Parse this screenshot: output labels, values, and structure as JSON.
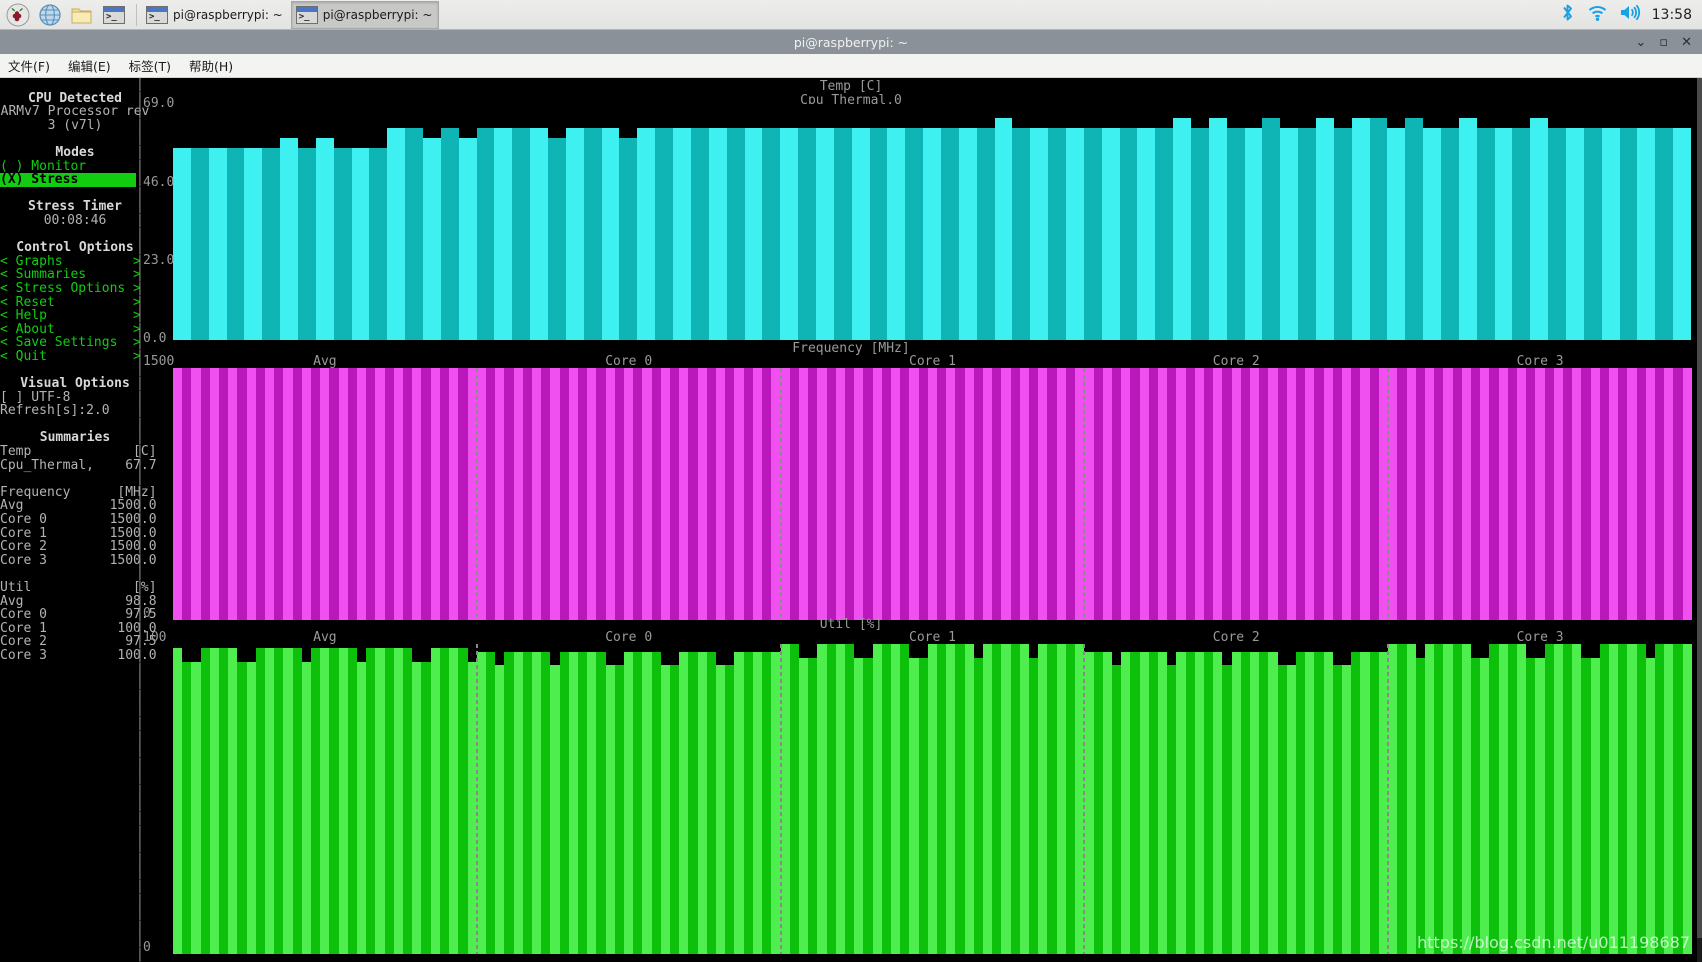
{
  "taskbar": {
    "launchers": [
      {
        "name": "raspberry-menu-icon",
        "label": "Raspberry Pi Menu"
      },
      {
        "name": "web-browser-icon",
        "label": "Web Browser"
      },
      {
        "name": "file-manager-icon",
        "label": "File Manager"
      },
      {
        "name": "terminal-icon",
        "label": "Terminal"
      }
    ],
    "windows": [
      {
        "label": "pi@raspberrypi: ~",
        "active": false
      },
      {
        "label": "pi@raspberrypi: ~",
        "active": true
      }
    ],
    "tray": [
      {
        "name": "bluetooth-icon"
      },
      {
        "name": "wifi-icon"
      },
      {
        "name": "volume-icon"
      }
    ],
    "clock": "13:58"
  },
  "window": {
    "title": "pi@raspberrypi: ~",
    "controls": [
      {
        "name": "minimize-button",
        "glyph": "⌄"
      },
      {
        "name": "maximize-button",
        "glyph": "▫"
      },
      {
        "name": "close-button",
        "glyph": "✕"
      }
    ]
  },
  "menubar": {
    "items": [
      {
        "label": "文件(F)",
        "name": "menu-file"
      },
      {
        "label": "编辑(E)",
        "name": "menu-edit"
      },
      {
        "label": "标签(T)",
        "name": "menu-tabs"
      },
      {
        "label": "帮助(H)",
        "name": "menu-help"
      }
    ]
  },
  "sidebar": {
    "cpu_detected": {
      "heading": "CPU Detected",
      "line1": "ARMv7 Processor rev",
      "line2": "3 (v7l)"
    },
    "modes": {
      "heading": "Modes",
      "options": [
        {
          "label": "( ) Monitor",
          "selected": false
        },
        {
          "label": "(X) Stress",
          "selected": true
        }
      ]
    },
    "stress_timer": {
      "heading": "Stress Timer",
      "value": "00:08:46"
    },
    "control_options": {
      "heading": "Control Options",
      "items": [
        {
          "label": "< Graphs         >"
        },
        {
          "label": "< Summaries      >"
        },
        {
          "label": "< Stress Options >"
        },
        {
          "label": "< Reset          >"
        },
        {
          "label": "< Help           >"
        },
        {
          "label": "< About          >"
        },
        {
          "label": "< Save Settings  >"
        },
        {
          "label": "< Quit           >"
        }
      ]
    },
    "visual_options": {
      "heading": "Visual Options",
      "utf8": "[ ] UTF-8",
      "refresh": "Refresh[s]:2.0"
    },
    "summaries": {
      "heading": "Summaries",
      "temp_header": "Temp             [C]",
      "temp_rows": [
        {
          "label": "Cpu_Thermal,",
          "value": "67.7"
        }
      ],
      "freq_header": "Frequency      [MHz]",
      "freq_rows": [
        {
          "label": "Avg",
          "value": "1500.0"
        },
        {
          "label": "Core 0",
          "value": "1500.0"
        },
        {
          "label": "Core 1",
          "value": "1500.0"
        },
        {
          "label": "Core 2",
          "value": "1500.0"
        },
        {
          "label": "Core 3",
          "value": "1500.0"
        }
      ],
      "util_header": "Util             [%]",
      "util_rows": [
        {
          "label": "Avg",
          "value": "98.8"
        },
        {
          "label": "Core 0",
          "value": "97.5"
        },
        {
          "label": "Core 1",
          "value": "100.0"
        },
        {
          "label": "Core 2",
          "value": "97.5"
        },
        {
          "label": "Core 3",
          "value": "100.0"
        }
      ]
    }
  },
  "charts": {
    "temp": {
      "title": "Temp [C]",
      "subtitle": "Cpu_Thermal,0",
      "yticks": [
        "69.0",
        "46.0",
        "23.0",
        "0.0"
      ],
      "color_light": "#3ef0ef",
      "color_dark": "#0fb4b4",
      "ylim": [
        0,
        69
      ],
      "values": [
        56,
        56,
        56,
        56,
        56,
        56,
        59,
        56,
        59,
        56,
        56,
        56,
        62,
        62,
        59,
        62,
        59,
        62,
        62,
        62,
        62,
        59,
        62,
        62,
        62,
        59,
        62,
        62,
        62,
        62,
        62,
        62,
        62,
        62,
        62,
        62,
        62,
        62,
        62,
        62,
        62,
        62,
        62,
        62,
        62,
        62,
        65,
        62,
        62,
        62,
        62,
        62,
        62,
        62,
        62,
        62,
        65,
        62,
        65,
        62,
        62,
        65,
        62,
        62,
        65,
        62,
        65,
        65,
        62,
        65,
        62,
        62,
        65,
        62,
        62,
        62,
        65,
        62,
        62,
        62,
        62,
        62,
        62,
        62,
        62
      ]
    },
    "frequency": {
      "title": "Frequency [MHz]",
      "ymax_label": "1500",
      "ymin_label": "0",
      "color_light": "#f050f0",
      "color_dark": "#bb18bb",
      "sections": [
        "Avg",
        "Core 0",
        "Core 1",
        "Core 2",
        "Core 3"
      ],
      "values": [
        1500,
        1500,
        1500,
        1500,
        1500
      ]
    },
    "util": {
      "title": "Util [%]",
      "ymax_label": "100",
      "ymin_label": "0",
      "color_light": "#4dee4d",
      "color_dark": "#0cc00c",
      "sections": [
        "Avg",
        "Core 0",
        "Core 1",
        "Core 2",
        "Core 3"
      ],
      "values": [
        98.8,
        97.5,
        100.0,
        97.5,
        100.0
      ]
    }
  },
  "watermark": "https://blog.csdn.net/u011198687"
}
